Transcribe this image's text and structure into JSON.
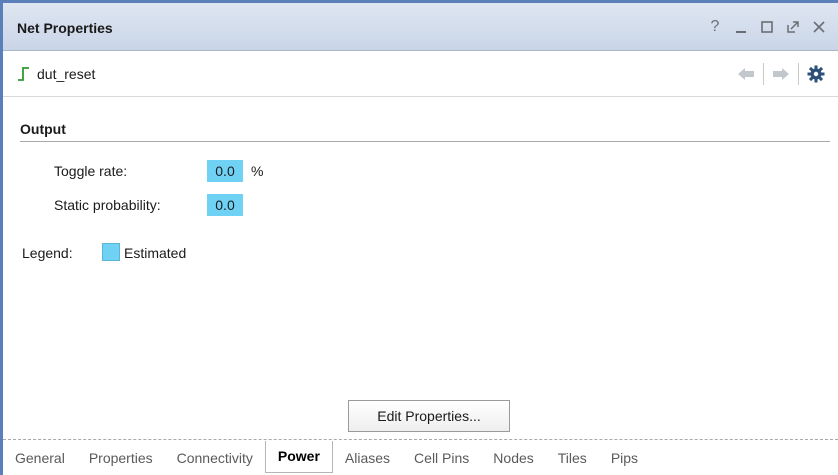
{
  "window": {
    "title": "Net Properties",
    "controls": [
      {
        "name": "help",
        "glyph": "?"
      },
      {
        "name": "minimize",
        "glyph": "_"
      },
      {
        "name": "maximize",
        "glyph": "□"
      },
      {
        "name": "float",
        "glyph": "⇱"
      },
      {
        "name": "close",
        "glyph": "✕"
      }
    ]
  },
  "net": {
    "name": "dut_reset",
    "icon": "signal-step-icon",
    "icon_color": "#2e9b2e"
  },
  "nav": {
    "back_icon": "arrow-left-icon",
    "forward_icon": "arrow-right-icon",
    "settings_icon": "gear-icon"
  },
  "output": {
    "section_title": "Output",
    "toggle_rate_label": "Toggle rate:",
    "toggle_rate_value": "0.0",
    "toggle_rate_unit": "%",
    "static_prob_label": "Static probability:",
    "static_prob_value": "0.0"
  },
  "legend": {
    "label": "Legend:",
    "estimated": "Estimated",
    "estimated_color": "#6fd2f5"
  },
  "edit_button": "Edit Properties...",
  "tabs": [
    {
      "label": "General",
      "active": false
    },
    {
      "label": "Properties",
      "active": false
    },
    {
      "label": "Connectivity",
      "active": false
    },
    {
      "label": "Power",
      "active": true
    },
    {
      "label": "Aliases",
      "active": false
    },
    {
      "label": "Cell Pins",
      "active": false
    },
    {
      "label": "Nodes",
      "active": false
    },
    {
      "label": "Tiles",
      "active": false
    },
    {
      "label": "Pips",
      "active": false
    }
  ]
}
